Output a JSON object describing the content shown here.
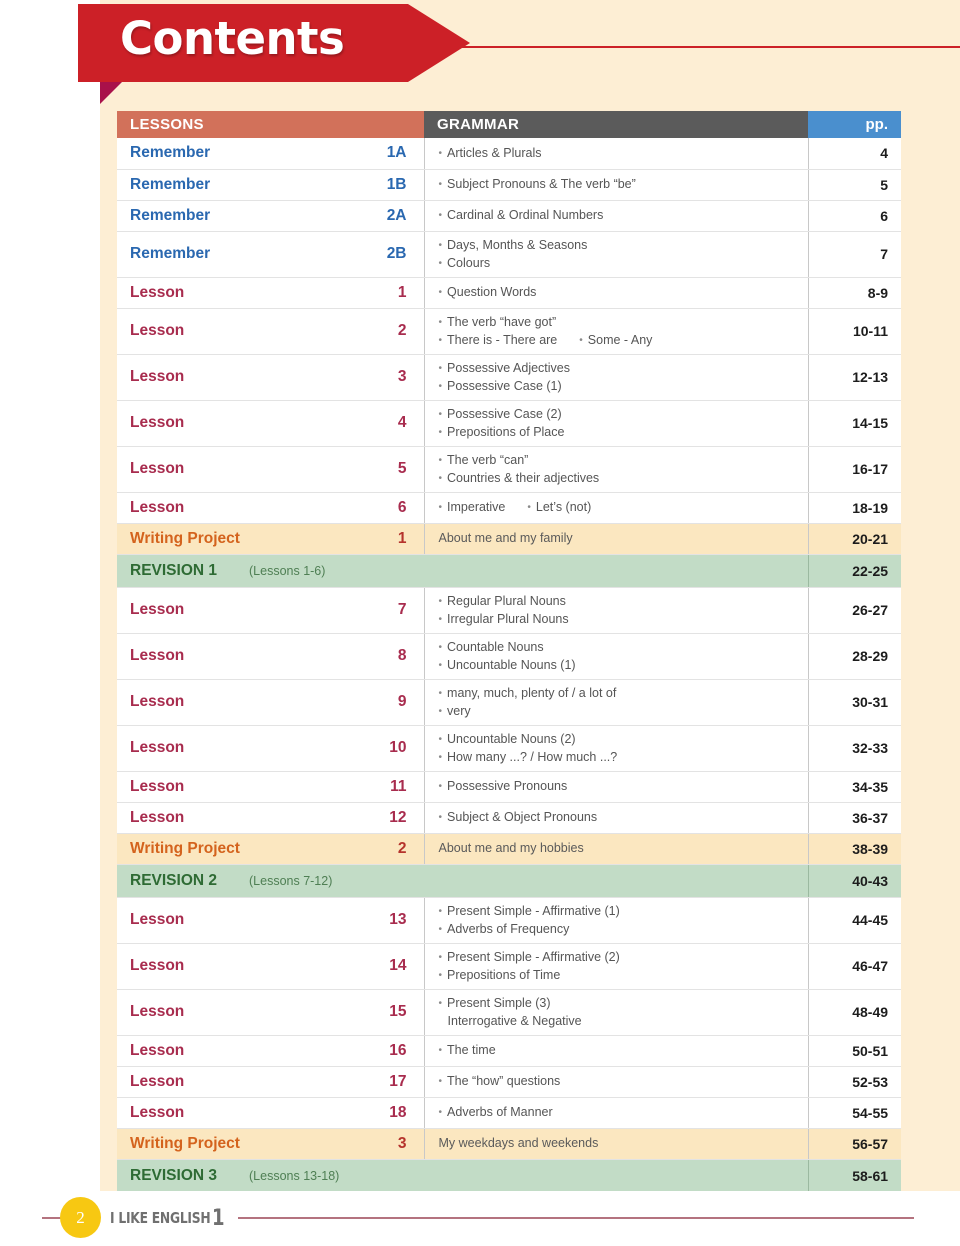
{
  "banner": {
    "title": "Contents"
  },
  "table": {
    "headers": {
      "lessons": "LESSONS",
      "grammar": "GRAMMAR",
      "pages": "pp."
    },
    "rows": [
      {
        "kind": "remember",
        "label": "Remember",
        "num": "1A",
        "grammar": [
          "Articles & Plurals"
        ],
        "pp": "4"
      },
      {
        "kind": "remember",
        "label": "Remember",
        "num": "1B",
        "grammar": [
          "Subject Pronouns & The verb “be”"
        ],
        "pp": "5"
      },
      {
        "kind": "remember",
        "label": "Remember",
        "num": "2A",
        "grammar": [
          "Cardinal & Ordinal Numbers"
        ],
        "pp": "6"
      },
      {
        "kind": "remember",
        "label": "Remember",
        "num": "2B",
        "grammar": [
          "Days, Months & Seasons",
          "Colours"
        ],
        "pp": "7"
      },
      {
        "kind": "lesson",
        "label": "Lesson",
        "num": "1",
        "grammar": [
          "Question Words"
        ],
        "pp": "8-9"
      },
      {
        "kind": "lesson",
        "label": "Lesson",
        "num": "2",
        "grammar": [
          "The verb “have got”",
          "There is - There are"
        ],
        "grammar_extra": "Some - Any",
        "pp": "10-11"
      },
      {
        "kind": "lesson",
        "label": "Lesson",
        "num": "3",
        "grammar": [
          "Possessive Adjectives",
          "Possessive Case (1)"
        ],
        "pp": "12-13"
      },
      {
        "kind": "lesson",
        "label": "Lesson",
        "num": "4",
        "grammar": [
          "Possessive Case (2)",
          "Prepositions of Place"
        ],
        "pp": "14-15"
      },
      {
        "kind": "lesson",
        "label": "Lesson",
        "num": "5",
        "grammar": [
          "The verb “can”",
          "Countries & their adjectives"
        ],
        "pp": "16-17"
      },
      {
        "kind": "lesson",
        "label": "Lesson",
        "num": "6",
        "grammar": [
          "Imperative"
        ],
        "grammar_extra": "Let’s (not)",
        "pp": "18-19"
      },
      {
        "kind": "project",
        "label": "Writing Project",
        "num": "1",
        "plain": "About me and my family",
        "pp": "20-21"
      },
      {
        "kind": "revision",
        "label": "REVISION 1",
        "sub": "(Lessons 1-6)",
        "pp": "22-25"
      },
      {
        "kind": "lesson",
        "label": "Lesson",
        "num": "7",
        "grammar": [
          "Regular Plural Nouns",
          "Irregular Plural Nouns"
        ],
        "pp": "26-27"
      },
      {
        "kind": "lesson",
        "label": "Lesson",
        "num": "8",
        "grammar": [
          "Countable Nouns",
          "Uncountable Nouns (1)"
        ],
        "pp": "28-29"
      },
      {
        "kind": "lesson",
        "label": "Lesson",
        "num": "9",
        "grammar": [
          "many, much, plenty of / a lot of",
          "very"
        ],
        "pp": "30-31"
      },
      {
        "kind": "lesson",
        "label": "Lesson",
        "num": "10",
        "grammar": [
          "Uncountable Nouns (2)",
          "How many ...? / How much ...?"
        ],
        "pp": "32-33"
      },
      {
        "kind": "lesson",
        "label": "Lesson",
        "num": "11",
        "grammar": [
          "Possessive Pronouns"
        ],
        "pp": "34-35"
      },
      {
        "kind": "lesson",
        "label": "Lesson",
        "num": "12",
        "grammar": [
          "Subject & Object Pronouns"
        ],
        "pp": "36-37"
      },
      {
        "kind": "project",
        "label": "Writing Project",
        "num": "2",
        "plain": "About me and my hobbies",
        "pp": "38-39"
      },
      {
        "kind": "revision",
        "label": "REVISION 2",
        "sub": "(Lessons 7-12)",
        "pp": "40-43"
      },
      {
        "kind": "lesson",
        "label": "Lesson",
        "num": "13",
        "grammar": [
          "Present Simple - Affirmative (1)",
          "Adverbs of Frequency"
        ],
        "pp": "44-45"
      },
      {
        "kind": "lesson",
        "label": "Lesson",
        "num": "14",
        "grammar": [
          "Present Simple - Affirmative (2)",
          "Prepositions of Time"
        ],
        "pp": "46-47"
      },
      {
        "kind": "lesson",
        "label": "Lesson",
        "num": "15",
        "grammar": [
          "Present Simple (3)"
        ],
        "grammar_nobullet": [
          "Interrogative & Negative"
        ],
        "pp": "48-49"
      },
      {
        "kind": "lesson",
        "label": "Lesson",
        "num": "16",
        "grammar": [
          "The time"
        ],
        "pp": "50-51"
      },
      {
        "kind": "lesson",
        "label": "Lesson",
        "num": "17",
        "grammar": [
          "The “how” questions"
        ],
        "pp": "52-53"
      },
      {
        "kind": "lesson",
        "label": "Lesson",
        "num": "18",
        "grammar": [
          "Adverbs of Manner"
        ],
        "pp": "54-55"
      },
      {
        "kind": "project",
        "label": "Writing Project",
        "num": "3",
        "plain": "My weekdays and weekends",
        "pp": "56-57"
      },
      {
        "kind": "revision",
        "label": "REVISION 3",
        "sub": "(Lessons 13-18)",
        "pp": "58-61"
      }
    ]
  },
  "footer": {
    "page_number": "2",
    "book_title": "I LIKE ENGLISH",
    "book_level": "1"
  },
  "colors": {
    "banner_red": "#cc2027",
    "banner_fold": "#a9114a",
    "page_cream": "#fdeed4",
    "header_lessons": "#d2715a",
    "header_grammar": "#5b5b5b",
    "header_pp": "#4a8fce",
    "remember_blue": "#2a68b0",
    "lesson_maroon": "#a82c4e",
    "project_orange": "#d4631d",
    "project_row_bg": "#fbe7c0",
    "revision_green": "#2e6b34",
    "revision_row_bg": "#c2dcc6",
    "badge_yellow": "#f7c812",
    "footer_rule": "#b4737f"
  }
}
